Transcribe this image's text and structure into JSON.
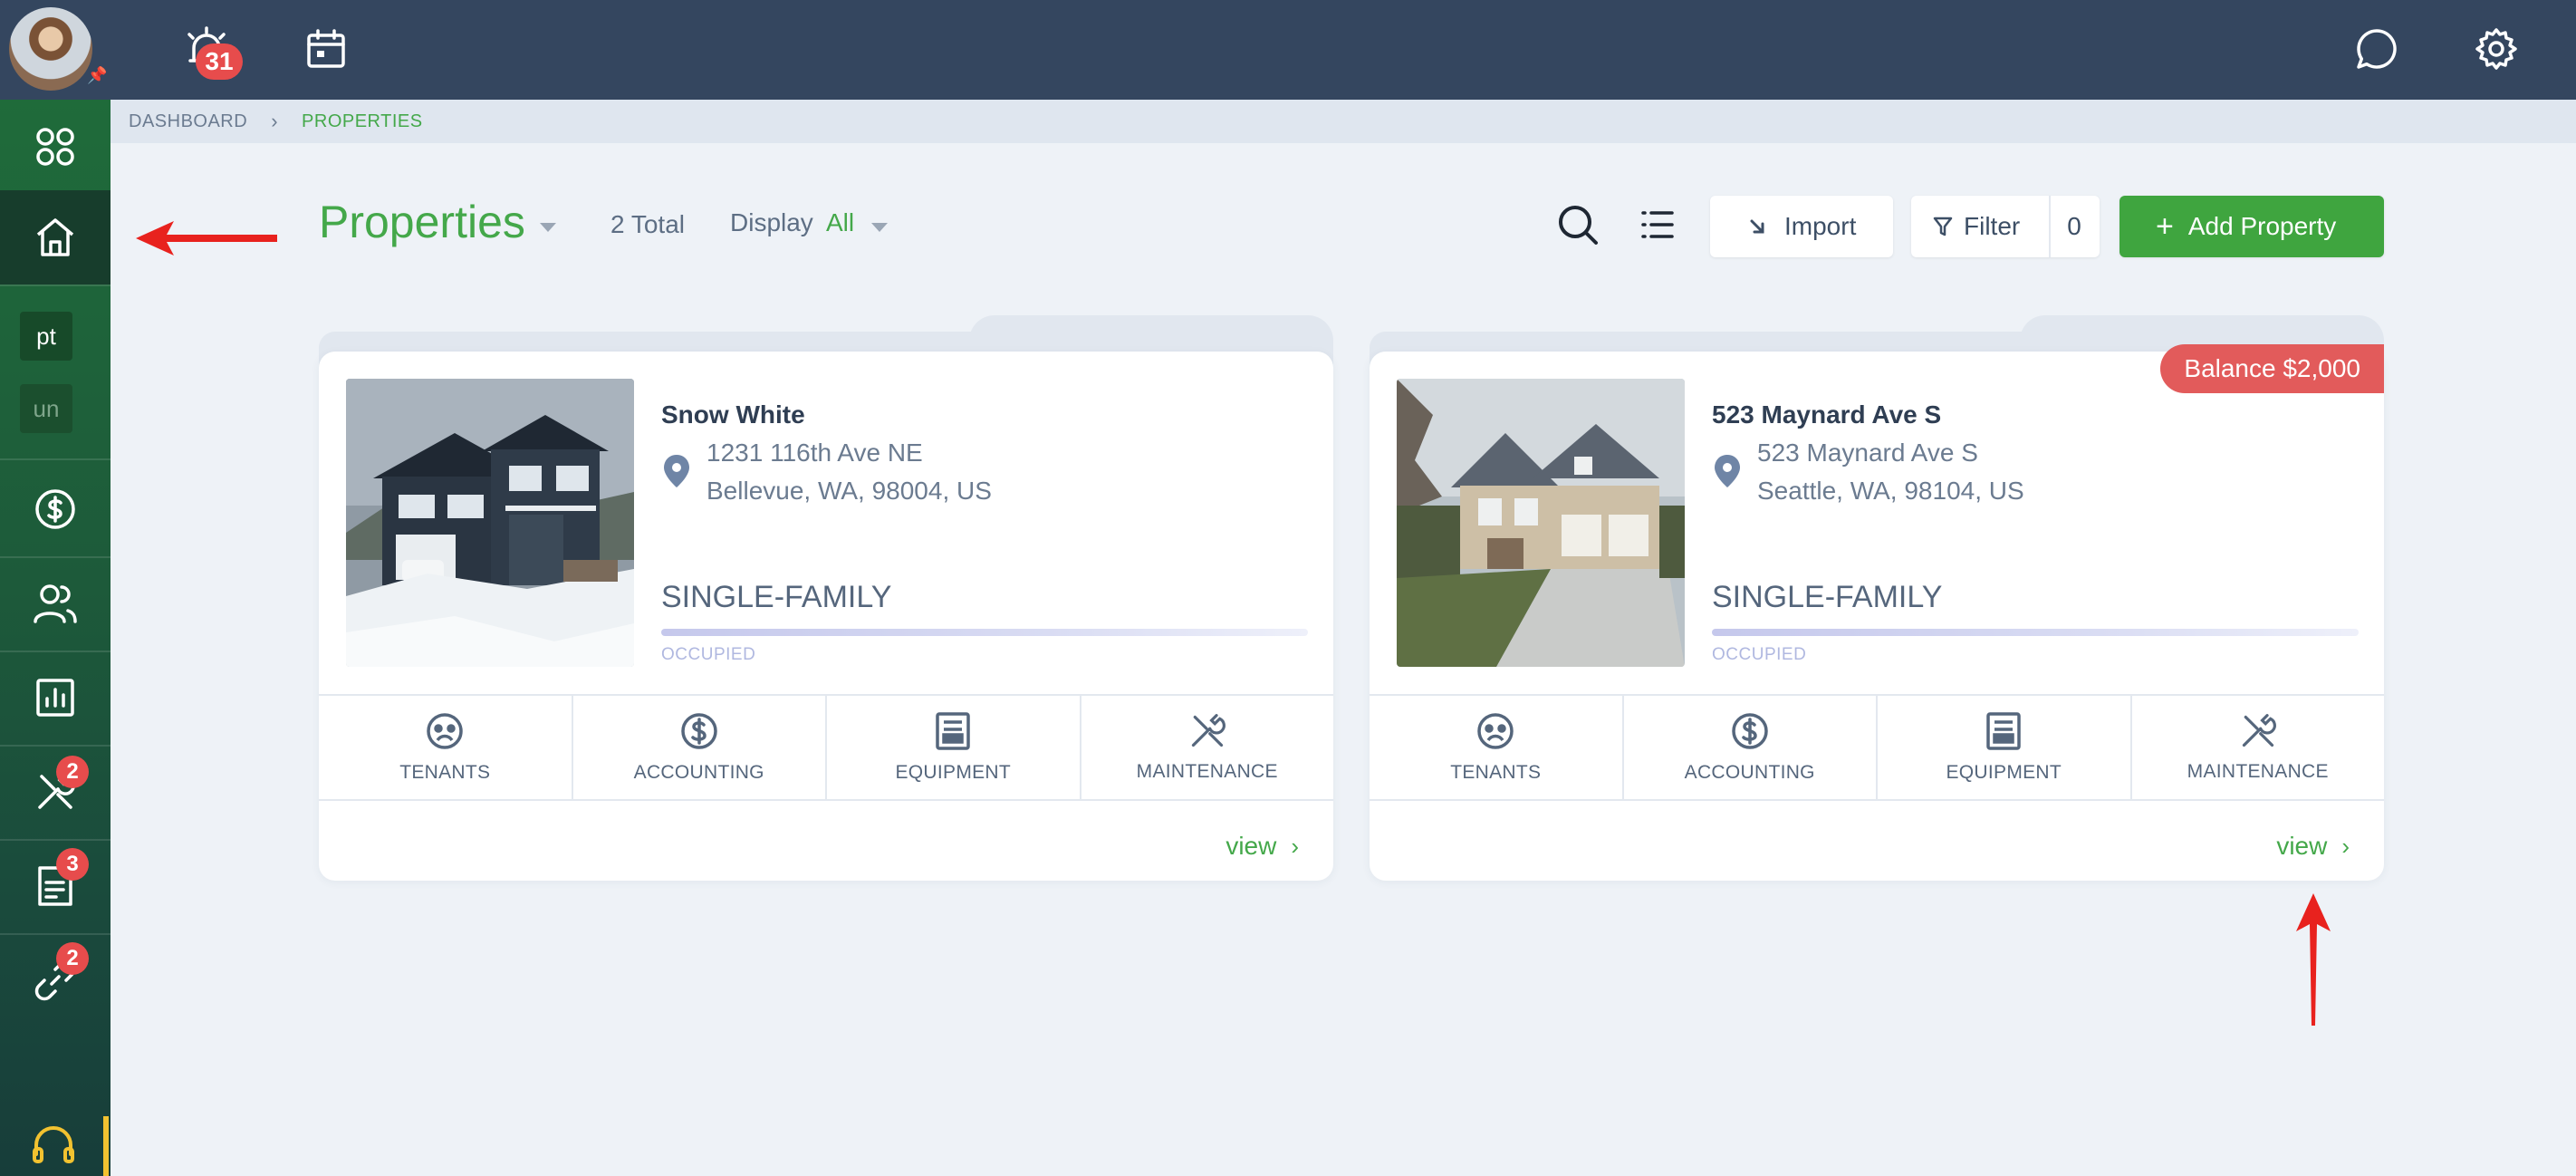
{
  "topbar": {
    "alarm_badge": "31"
  },
  "sidebar": {
    "chip_pt": "pt",
    "chip_un": "un",
    "badges": {
      "maintenance": "2",
      "documents": "3",
      "links": "2"
    }
  },
  "breadcrumb": {
    "home": "DASHBOARD",
    "separator": "›",
    "current": "PROPERTIES"
  },
  "header": {
    "title": "Properties",
    "total": "2 Total",
    "display_label": "Display",
    "display_value": "All",
    "import_label": "Import",
    "filter_label": "Filter",
    "filter_count": "0",
    "add_label": "Add Property"
  },
  "properties": [
    {
      "name": "Snow White",
      "address_line1": "1231 116th Ave NE",
      "address_line2": "Bellevue, WA, 98004, US",
      "type": "SINGLE-FAMILY",
      "status": "OCCUPIED",
      "view": "view"
    },
    {
      "name": "523 Maynard Ave S",
      "address_line1": "523 Maynard Ave S",
      "address_line2": "Seattle, WA, 98104, US",
      "type": "SINGLE-FAMILY",
      "status": "OCCUPIED",
      "balance": "Balance $2,000",
      "view": "view"
    }
  ],
  "card_tabs": [
    "TENANTS",
    "ACCOUNTING",
    "EQUIPMENT",
    "MAINTENANCE"
  ],
  "colors": {
    "accent": "#44a84a",
    "topbar": "#34465f",
    "sidebar": "#1f6b3a",
    "badge": "#e74c4c",
    "balance": "#e25b5b"
  }
}
